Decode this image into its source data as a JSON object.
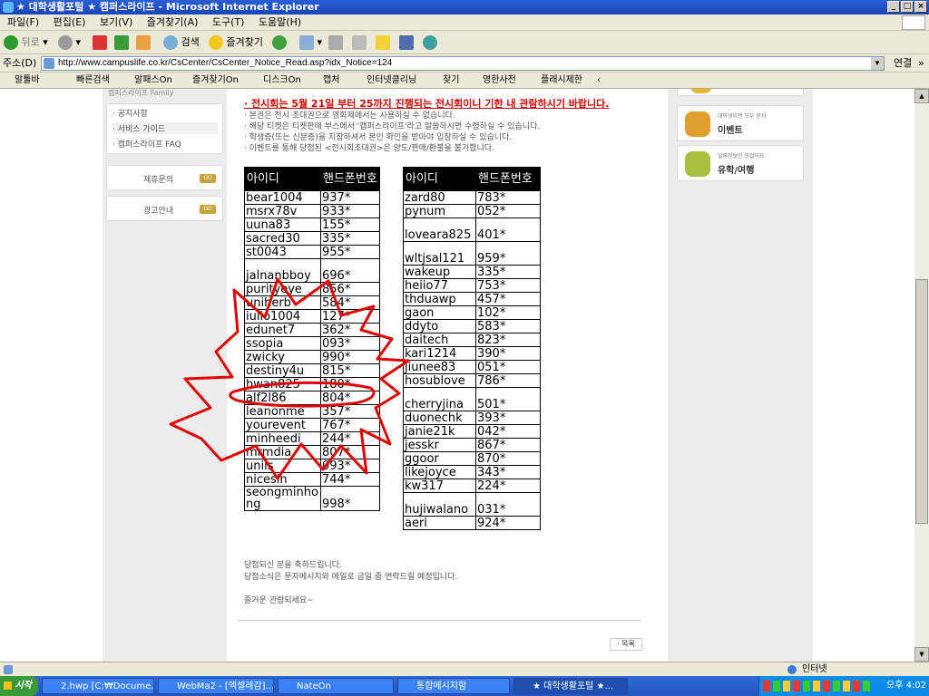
{
  "window": {
    "title": "★ 대학생활포털 ★ 캠퍼스라이프 - Microsoft Internet Explorer",
    "btn_min": "_",
    "btn_max": "□",
    "btn_close": "×"
  },
  "menu": [
    "파일(F)",
    "편집(E)",
    "보기(V)",
    "즐겨찾기(A)",
    "도구(T)",
    "도움말(H)"
  ],
  "toolbar": {
    "back": "뒤로",
    "search": "검색",
    "favorites": "즐겨찾기"
  },
  "address": {
    "label": "주소(D)",
    "url": "http://www.campuslife.co.kr/CsCenter/CsCenter_Notice_Read.asp?idx_Notice=124",
    "go": "연결"
  },
  "links": [
    "알툴바",
    "빠른검색",
    "알패스On",
    "즐겨찾기On",
    "디스크On",
    "캡처",
    "인터넷클리닝",
    "찾기",
    "영한사전",
    "플래시제한"
  ],
  "sidebar": {
    "header": "캠퍼스라이프 Family",
    "items": [
      "· 공지사항",
      "· 서비스 가이드",
      "· 캠퍼스라이프 FAQ"
    ],
    "buttons": [
      {
        "label": "제휴문의",
        "go": "GO"
      },
      {
        "label": "광고안내",
        "go": "GO"
      }
    ]
  },
  "notice": {
    "red_line": "· 전시회는 5월 21일 부터 25까지 진행되는 전시회이니 기한 내 관람하시기 바랍니다.",
    "lines": [
      "· 본권은 전시 초대권으로 영화제에서는 사용하실 수 없습니다.",
      "· 해당 티켓은 티켓판매 부스에서 '캠퍼스라이프'라고 말씀하시면 수령하실 수 있습니다.",
      "· 학생증(또는 신분증)을 지참하셔서 본인 확인을 받아야 입장하실 수 있습니다.",
      "· 이벤트를 통해 당첨된 <전시회초대권>은 양도/판매/환불을 불가합니다."
    ]
  },
  "table_headers": [
    "아이디",
    "핸드폰번호"
  ],
  "table_left": [
    [
      "bear1004",
      "937*"
    ],
    [
      "msrx78v",
      "933*"
    ],
    [
      "uuna83",
      "155*"
    ],
    [
      "sacred30",
      "335*"
    ],
    [
      "st0043",
      "955*"
    ],
    [
      "jalnanbboy",
      "696*"
    ],
    [
      "purityeye",
      "856*"
    ],
    [
      "uniherb",
      "584*"
    ],
    [
      "iulio1004",
      "127*"
    ],
    [
      "edunet7",
      "362*"
    ],
    [
      "ssopia",
      "093*"
    ],
    [
      "zwicky",
      "990*"
    ],
    [
      "destiny4u",
      "815*"
    ],
    [
      "hwan825",
      "180*"
    ],
    [
      "alf2l86",
      "804*"
    ],
    [
      "leanonme",
      "357*"
    ],
    [
      "yourevent",
      "767*"
    ],
    [
      "minheedi",
      "244*"
    ],
    [
      "mrmdia",
      "807*"
    ],
    [
      "unils",
      "093*"
    ],
    [
      "nicesin",
      "744*"
    ],
    [
      "seongminhong",
      "998*"
    ]
  ],
  "table_right": [
    [
      "zard80",
      "783*"
    ],
    [
      "pynum",
      "052*"
    ],
    [
      "loveara825",
      "401*"
    ],
    [
      "wltjsal121",
      "959*"
    ],
    [
      "wakeup",
      "335*"
    ],
    [
      "heiio77",
      "753*"
    ],
    [
      "thduawp",
      "457*"
    ],
    [
      "gaon",
      "102*"
    ],
    [
      "ddyto",
      "583*"
    ],
    [
      "daitech",
      "823*"
    ],
    [
      "kari1214",
      "390*"
    ],
    [
      "jiunee83",
      "051*"
    ],
    [
      "hosublove",
      "786*"
    ],
    [
      "cherryjina",
      "501*"
    ],
    [
      "duonechk",
      "393*"
    ],
    [
      "janie21k",
      "042*"
    ],
    [
      "jesskr",
      "867*"
    ],
    [
      "ggoor",
      "870*"
    ],
    [
      "likejoyce",
      "343*"
    ],
    [
      "kw317",
      "224*"
    ],
    [
      "hujiwalano",
      "031*"
    ],
    [
      "aeri",
      "924*"
    ]
  ],
  "closing": [
    "당첨되신 분을 축하드립니다.",
    "당첨소식은 문자메시지와 메일로 금일 중 연락드릴 예정입니다.",
    "즐거운 관람되세요~"
  ],
  "list_button": "· 목록",
  "right": [
    {
      "small": "대학생이면 모두 받자",
      "label": "이벤트"
    },
    {
      "small": "알짜정보만 모았어요",
      "label": "유학/여행"
    }
  ],
  "status": {
    "zone": "인터넷"
  },
  "taskbar": {
    "start": "시작",
    "tasks": [
      "2.hwp [C:₩Docume...",
      "WebMa2 - [엑셀레감]...",
      "NateOn",
      "통합메시지함",
      "★ 대학생활포털 ★..."
    ],
    "clock": "오후 4:02"
  },
  "colors": {
    "accent_red": "#d40000",
    "title_blue": "#2a5fd6",
    "go_badge": "#c8a23c"
  }
}
